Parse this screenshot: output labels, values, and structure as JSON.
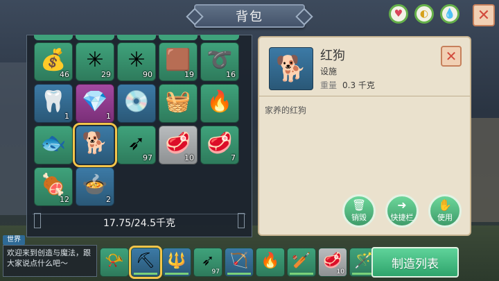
{
  "title": "背包",
  "top_buttons": [
    {
      "name": "health-status",
      "icon": "heart-icon",
      "glyph": "♥",
      "color": "#d9465a"
    },
    {
      "name": "hunger-status",
      "icon": "food-icon",
      "glyph": "◐",
      "color": "#d6a11c"
    },
    {
      "name": "water-status",
      "icon": "water-drop-icon",
      "glyph": "💧",
      "color": "#3aa0c8"
    }
  ],
  "close_label": "✕",
  "inventory": {
    "weight": "17.75/24.5千克",
    "slots": [
      {
        "icon": "gold-ore-icon",
        "glyph": "💰",
        "qty": "46",
        "color": "green"
      },
      {
        "icon": "green-rune-icon",
        "glyph": "✳",
        "qty": "29",
        "color": "green"
      },
      {
        "icon": "green-rune-icon",
        "glyph": "✳",
        "qty": "90",
        "color": "green"
      },
      {
        "icon": "leather-hide-icon",
        "glyph": "🟫",
        "qty": "19",
        "color": "green"
      },
      {
        "icon": "rope-icon",
        "glyph": "➰",
        "qty": "16",
        "color": "green"
      },
      {
        "icon": "horn-icon",
        "glyph": "🦷",
        "qty": "1",
        "color": "blue"
      },
      {
        "icon": "blue-crystal-icon",
        "glyph": "💎",
        "qty": "1",
        "color": "purple"
      },
      {
        "icon": "stone-disc-icon",
        "glyph": "💿",
        "qty": "",
        "color": "blue"
      },
      {
        "icon": "pet-cage-icon",
        "glyph": "🧺",
        "qty": "",
        "color": "green"
      },
      {
        "icon": "campfire-icon",
        "glyph": "🔥",
        "qty": "",
        "color": "green"
      },
      {
        "icon": "fish-fillet-icon",
        "glyph": "🐟",
        "qty": "",
        "color": "green"
      },
      {
        "icon": "dog-icon",
        "glyph": "🐕",
        "qty": "",
        "color": "blue",
        "selected": true
      },
      {
        "icon": "arrows-icon",
        "glyph": "➶",
        "qty": "97",
        "color": "green"
      },
      {
        "icon": "raw-meat-icon",
        "glyph": "🥩",
        "qty": "10",
        "color": "grey"
      },
      {
        "icon": "raw-meat-icon",
        "glyph": "🥩",
        "qty": "7",
        "color": "green"
      },
      {
        "icon": "cooked-meat-icon",
        "glyph": "🍖",
        "qty": "12",
        "color": "green"
      },
      {
        "icon": "soup-bowl-icon",
        "glyph": "🍲",
        "qty": "2",
        "color": "blue"
      }
    ]
  },
  "detail": {
    "name": "红狗",
    "type": "设施",
    "weight_label": "重量",
    "weight_value": "0.3 千克",
    "description": "家养的红狗",
    "portrait_glyph": "🐕",
    "actions": [
      {
        "name": "destroy-button",
        "icon": "trash-icon",
        "glyph": "🗑",
        "label": "销毁"
      },
      {
        "name": "quickbar-button",
        "icon": "arrow-icon",
        "glyph": "➜",
        "label": "快捷栏"
      },
      {
        "name": "use-button",
        "icon": "hand-icon",
        "glyph": "✋",
        "label": "使用"
      }
    ]
  },
  "chat": {
    "tag": "世界",
    "message": "欢迎来到创造与魔法，跟大家说点什么吧～"
  },
  "hotbar": [
    {
      "icon": "horn-trumpet-icon",
      "glyph": "📯",
      "qty": "",
      "color": "green"
    },
    {
      "icon": "pickaxe-icon",
      "glyph": "⛏",
      "qty": "",
      "color": "blue",
      "selected": true,
      "durability": true
    },
    {
      "icon": "spear-icon",
      "glyph": "🔱",
      "qty": "",
      "color": "blue",
      "durability": true
    },
    {
      "icon": "arrows-icon",
      "glyph": "➶",
      "qty": "97",
      "color": "green"
    },
    {
      "icon": "bow-icon",
      "glyph": "🏹",
      "qty": "",
      "color": "blue",
      "durability": true
    },
    {
      "icon": "campfire-icon",
      "glyph": "🔥",
      "qty": "",
      "color": "green"
    },
    {
      "icon": "club-icon",
      "glyph": "🏏",
      "qty": "",
      "color": "green",
      "durability": true
    },
    {
      "icon": "raw-meat-icon",
      "glyph": "🥩",
      "qty": "10",
      "color": "grey"
    },
    {
      "icon": "magic-staff-icon",
      "glyph": "🪄",
      "qty": "",
      "color": "green",
      "durability": true
    }
  ],
  "craft_label": "制造列表"
}
